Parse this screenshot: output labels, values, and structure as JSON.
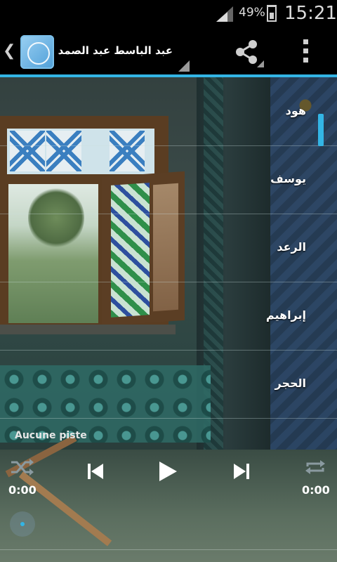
{
  "status_bar": {
    "battery_percent": "49%",
    "time": "15:21",
    "battery_level": 0.49,
    "icons": [
      "signal-icon",
      "battery-icon"
    ]
  },
  "action_bar": {
    "reciter_name": "عبد الباسط عبد الصمد",
    "icons": [
      "back-chevron-icon",
      "quran-app-icon",
      "share-icon",
      "overflow-menu-icon"
    ],
    "accent_color": "#33b5e5"
  },
  "surahs": [
    {
      "label": "هود"
    },
    {
      "label": "يوسف"
    },
    {
      "label": "الرعد"
    },
    {
      "label": "إبراهيم"
    },
    {
      "label": "الحجر"
    }
  ],
  "player": {
    "track_name": "Aucune piste",
    "elapsed": "0:00",
    "duration": "0:00",
    "progress": 0,
    "icons": [
      "shuffle-icon",
      "previous-icon",
      "play-icon",
      "next-icon",
      "repeat-icon"
    ]
  }
}
